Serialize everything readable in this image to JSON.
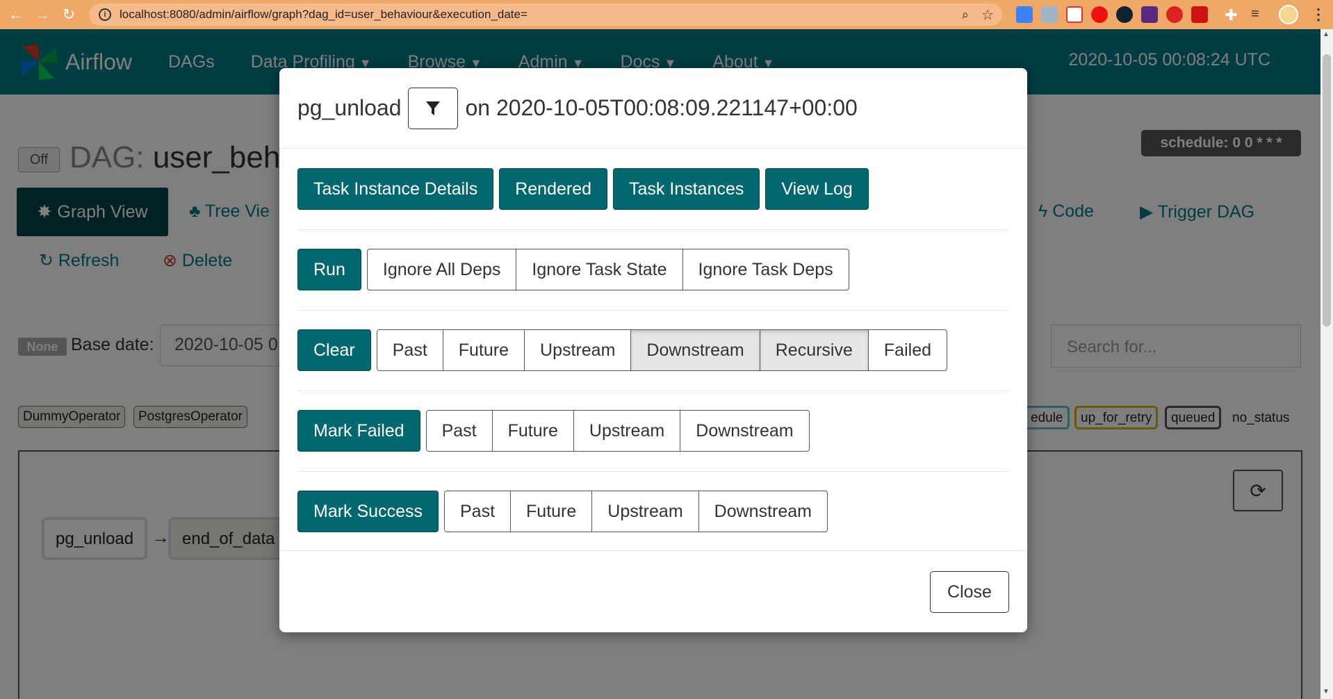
{
  "browser": {
    "url": "localhost:8080/admin/airflow/graph?dag_id=user_behaviour&execution_date=",
    "bar_color": "#f0a868"
  },
  "navbar": {
    "brand": "Airflow",
    "items": [
      {
        "label": "DAGs",
        "dropdown": false
      },
      {
        "label": "Data Profiling",
        "dropdown": true
      },
      {
        "label": "Browse",
        "dropdown": true
      },
      {
        "label": "Admin",
        "dropdown": true
      },
      {
        "label": "Docs",
        "dropdown": true
      },
      {
        "label": "About",
        "dropdown": true
      }
    ],
    "clock": "2020-10-05 00:08:24 UTC",
    "color": "#007a87"
  },
  "dag": {
    "toggle": "Off",
    "label": "DAG:",
    "name": "user_beha",
    "schedule": "schedule: 0 0 * * *"
  },
  "tabs": {
    "graph_view": "Graph View",
    "tree_view": "Tree Vie",
    "code": "Code",
    "trigger": "Trigger DAG",
    "refresh": "Refresh",
    "delete": "Delete"
  },
  "filters": {
    "none_badge": "None",
    "base_date_label": "Base date:",
    "base_date_value": "2020-10-05 0",
    "search_placeholder": "Search for..."
  },
  "operators": [
    "DummyOperator",
    "PostgresOperator"
  ],
  "states": [
    {
      "label": "edule",
      "color": "#5bc0c8"
    },
    {
      "label": "up_for_retry",
      "color": "#d4b200"
    },
    {
      "label": "queued",
      "color": "#555555"
    },
    {
      "label": "no_status",
      "color": ""
    }
  ],
  "graph": {
    "nodes": [
      "pg_unload",
      "end_of_data"
    ],
    "edge": "→"
  },
  "modal": {
    "task": "pg_unload",
    "on_text": "on 2020-10-05T00:08:09.221147+00:00",
    "top_buttons": [
      "Task Instance Details",
      "Rendered",
      "Task Instances",
      "View Log"
    ],
    "run": {
      "label": "Run",
      "options": [
        "Ignore All Deps",
        "Ignore Task State",
        "Ignore Task Deps"
      ]
    },
    "clear": {
      "label": "Clear",
      "options": [
        "Past",
        "Future",
        "Upstream",
        "Downstream",
        "Recursive",
        "Failed"
      ],
      "active": [
        "Downstream",
        "Recursive"
      ]
    },
    "mark_failed": {
      "label": "Mark Failed",
      "options": [
        "Past",
        "Future",
        "Upstream",
        "Downstream"
      ]
    },
    "mark_success": {
      "label": "Mark Success",
      "options": [
        "Past",
        "Future",
        "Upstream",
        "Downstream"
      ]
    },
    "close": "Close",
    "primary_color": "#03676f"
  }
}
